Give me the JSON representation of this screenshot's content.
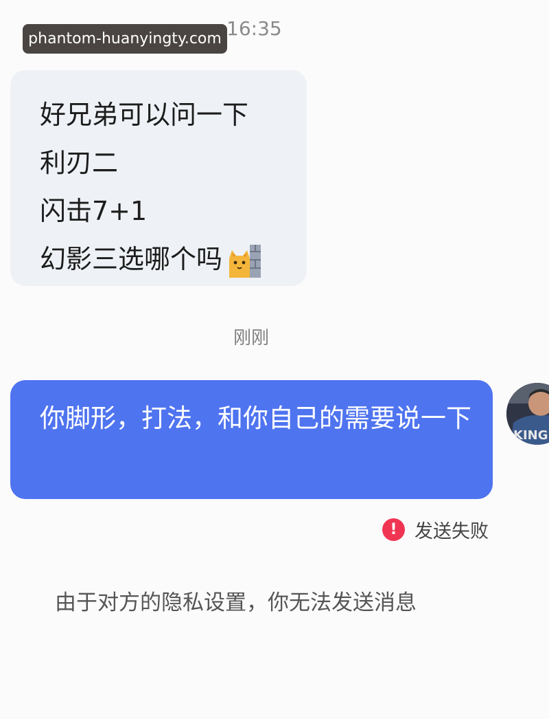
{
  "watermark": {
    "text": "phantom-huanyingty.com"
  },
  "status": {
    "time": "16:35"
  },
  "incoming_message": {
    "lines": [
      "好兄弟可以问一下",
      "利刃二",
      "闪击7+1",
      "幻影三选哪个吗"
    ],
    "emoji": "cat-peeking-emoji"
  },
  "divider_time": "刚刚",
  "outgoing_message": {
    "text": "你脚形，打法，和你自己的需要说一下",
    "bubble_color": "#4f74f0"
  },
  "send_status": {
    "icon_glyph": "!",
    "icon_name": "error-icon",
    "icon_color": "#f03553",
    "text": "发送失败"
  },
  "system_notice": "由于对方的隐私设置，你无法发送消息"
}
